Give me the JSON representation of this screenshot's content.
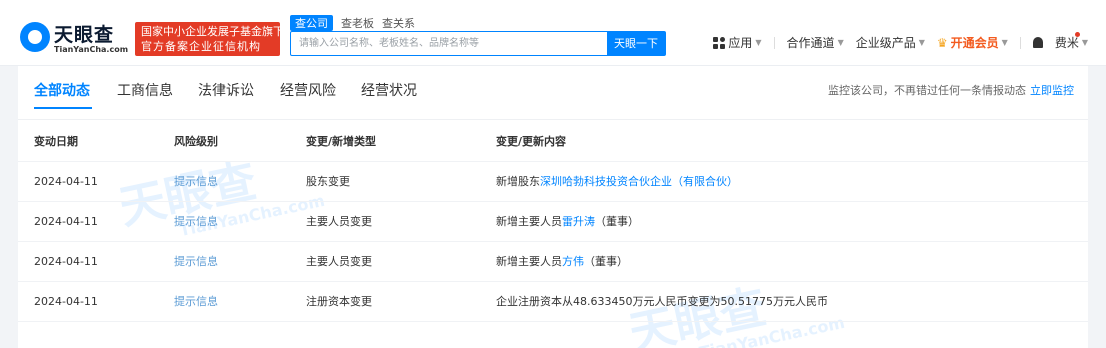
{
  "brand": {
    "logo_text": "天眼查",
    "logo_sub": "TianYanCha.com",
    "badge_line1": "国家中小企业发展子基金旗下",
    "badge_line2": "官方备案企业征信机构"
  },
  "search": {
    "tabs": [
      "查公司",
      "查老板",
      "查关系"
    ],
    "placeholder": "请输入公司名称、老板姓名、品牌名称等",
    "button": "天眼一下"
  },
  "nav": {
    "apps": "应用",
    "channel": "合作通道",
    "enterprise": "企业级产品",
    "vip": "开通会员",
    "user": "费米"
  },
  "tabs": [
    "全部动态",
    "工商信息",
    "法律诉讼",
    "经营风险",
    "经营状况"
  ],
  "monitor": {
    "text": "监控该公司，不再错过任何一条情报动态",
    "link": "立即监控"
  },
  "table": {
    "headers": [
      "变动日期",
      "风险级别",
      "变更/新增类型",
      "变更/更新内容"
    ],
    "rows": [
      {
        "date": "2024-04-11",
        "risk": "提示信息",
        "type": "股东变更",
        "prefix": "新增股东",
        "link": "深圳哈勃科技投资合伙企业（有限合伙）",
        "suffix": ""
      },
      {
        "date": "2024-04-11",
        "risk": "提示信息",
        "type": "主要人员变更",
        "prefix": "新增主要人员",
        "link": "雷升涛",
        "suffix": "（董事）"
      },
      {
        "date": "2024-04-11",
        "risk": "提示信息",
        "type": "主要人员变更",
        "prefix": "新增主要人员",
        "link": "方伟",
        "suffix": "（董事）"
      },
      {
        "date": "2024-04-11",
        "risk": "提示信息",
        "type": "注册资本变更",
        "prefix": "企业注册资本从48.633450万元人民币变更为50.51775万元人民币",
        "link": "",
        "suffix": ""
      }
    ]
  },
  "colors": {
    "accent": "#0084ff",
    "badge": "#e33b26",
    "vip": "#f35b1f"
  },
  "watermark": {
    "text": "天眼查",
    "sub": "TianYanCha.com"
  }
}
